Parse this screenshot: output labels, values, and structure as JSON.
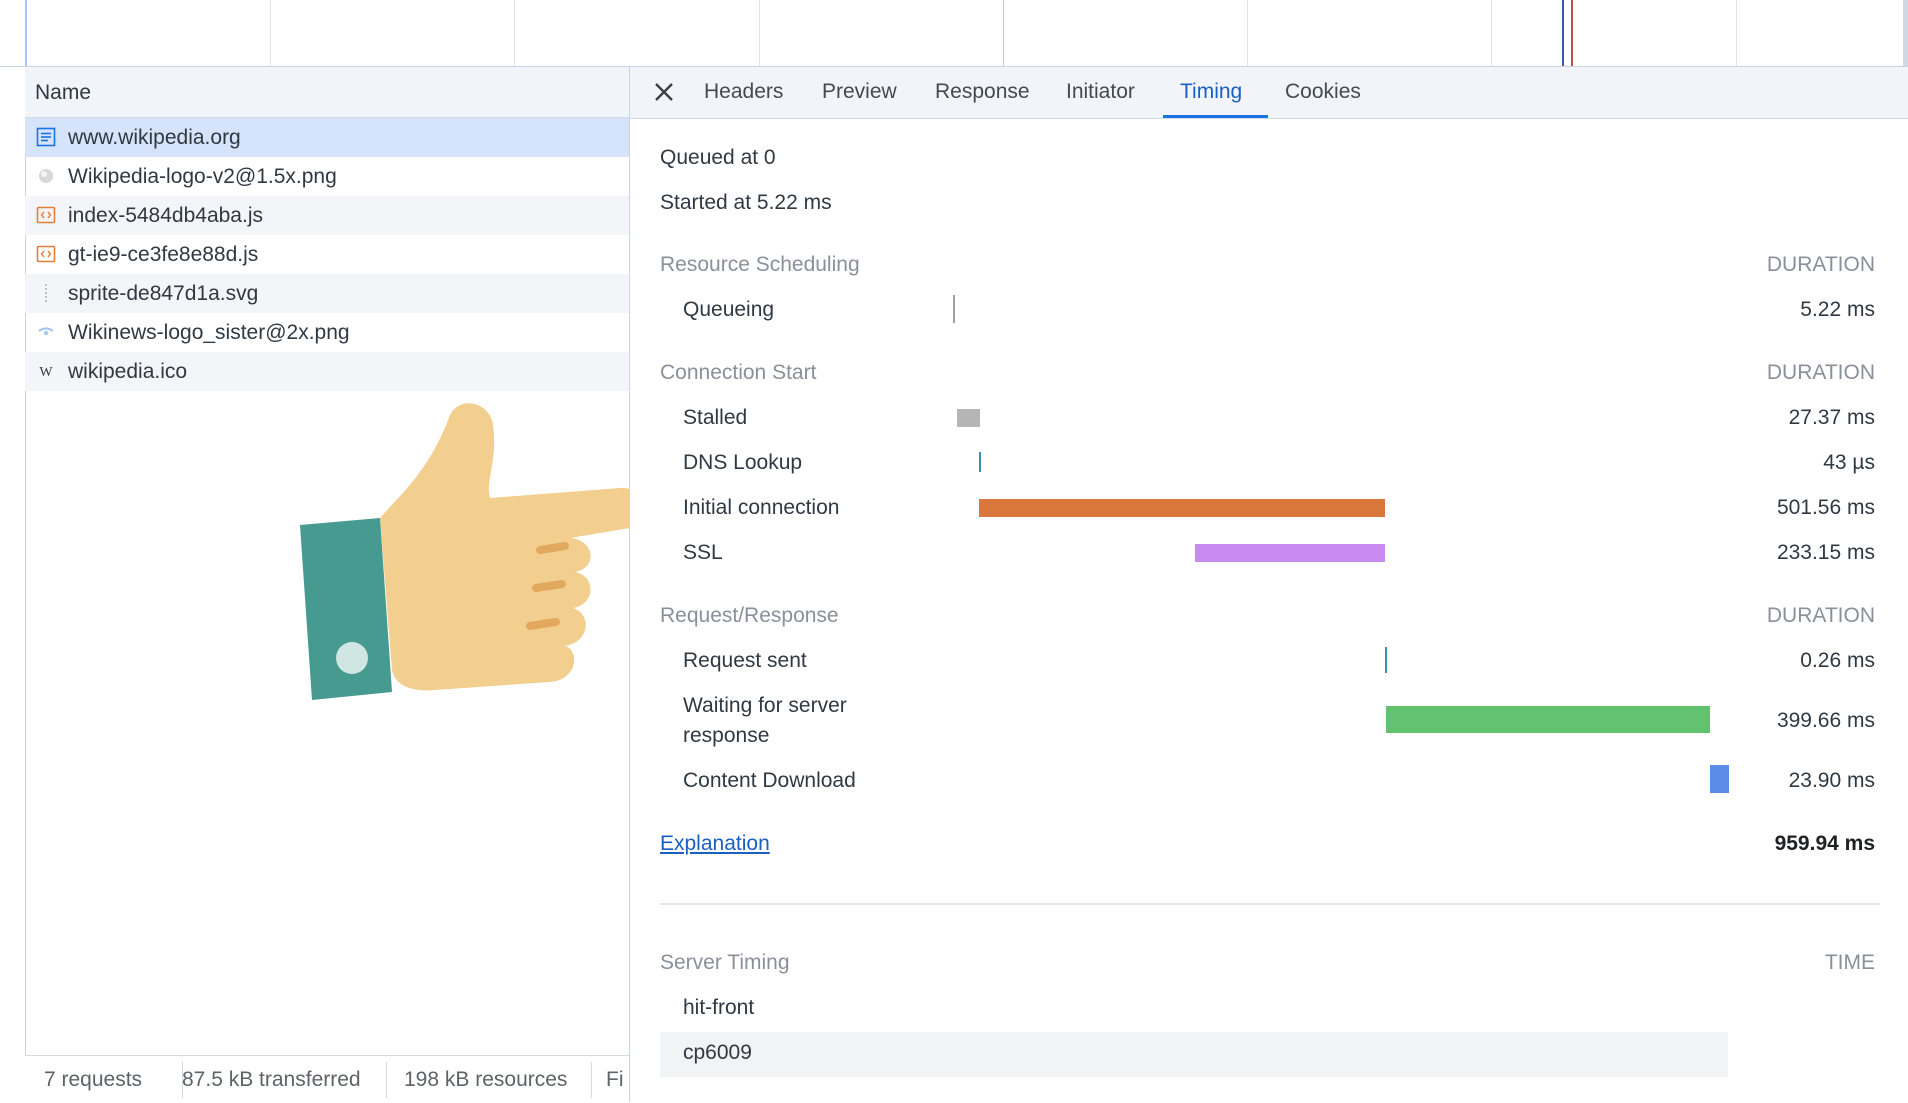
{
  "overview": {
    "markers": [
      {
        "name": "dom-content-loaded",
        "color": "#3b5ba5"
      },
      {
        "name": "load",
        "color": "#c0504d"
      }
    ]
  },
  "request_list": {
    "header": "Name",
    "rows": [
      {
        "name": "www.wikipedia.org",
        "icon": "document-icon",
        "selected": true
      },
      {
        "name": "Wikipedia-logo-v2@1.5x.png",
        "icon": "image-icon",
        "selected": false
      },
      {
        "name": "index-5484db4aba.js",
        "icon": "script-icon",
        "selected": false
      },
      {
        "name": "gt-ie9-ce3fe8e88d.js",
        "icon": "script-icon",
        "selected": false
      },
      {
        "name": "sprite-de847d1a.svg",
        "icon": "svg-icon",
        "selected": false
      },
      {
        "name": "Wikinews-logo_sister@2x.png",
        "icon": "image-icon",
        "selected": false
      },
      {
        "name": "wikipedia.ico",
        "icon": "favicon-icon",
        "selected": false
      }
    ]
  },
  "status_bar": {
    "requests": "7 requests",
    "transferred": "87.5 kB transferred",
    "resources": "198 kB resources",
    "finish": "Fi"
  },
  "tabs": [
    "Headers",
    "Preview",
    "Response",
    "Initiator",
    "Timing",
    "Cookies"
  ],
  "active_tab": "Timing",
  "timing": {
    "queued": "Queued at 0",
    "started": "Started at 5.22 ms",
    "duration_label": "DURATION",
    "sections": [
      {
        "title": "Resource Scheduling",
        "rows": [
          {
            "label": "Queueing",
            "value": "5.22 ms"
          }
        ]
      },
      {
        "title": "Connection Start",
        "rows": [
          {
            "label": "Stalled",
            "value": "27.37 ms"
          },
          {
            "label": "DNS Lookup",
            "value": "43 µs"
          },
          {
            "label": "Initial connection",
            "value": "501.56 ms"
          },
          {
            "label": "SSL",
            "value": "233.15 ms"
          }
        ]
      },
      {
        "title": "Request/Response",
        "rows": [
          {
            "label": "Request sent",
            "value": "0.26 ms"
          },
          {
            "label": "Waiting for server",
            "label2": "response",
            "value": "399.66 ms"
          },
          {
            "label": "Content Download",
            "value": "23.90 ms"
          }
        ]
      }
    ],
    "explanation": "Explanation",
    "total": "959.94 ms",
    "bar_colors": {
      "queueing": "#a0a0a0",
      "stalled": "#b5b5b5",
      "dns": "#3f8fb5",
      "initial_connection": "#d9783a",
      "ssl": "#c98af0",
      "request_sent": "#3f8fb5",
      "waiting": "#63c26f",
      "download": "#5b8de8"
    }
  },
  "server_timing": {
    "title": "Server Timing",
    "time_label": "TIME",
    "rows": [
      "hit-front",
      "cp6009"
    ]
  }
}
